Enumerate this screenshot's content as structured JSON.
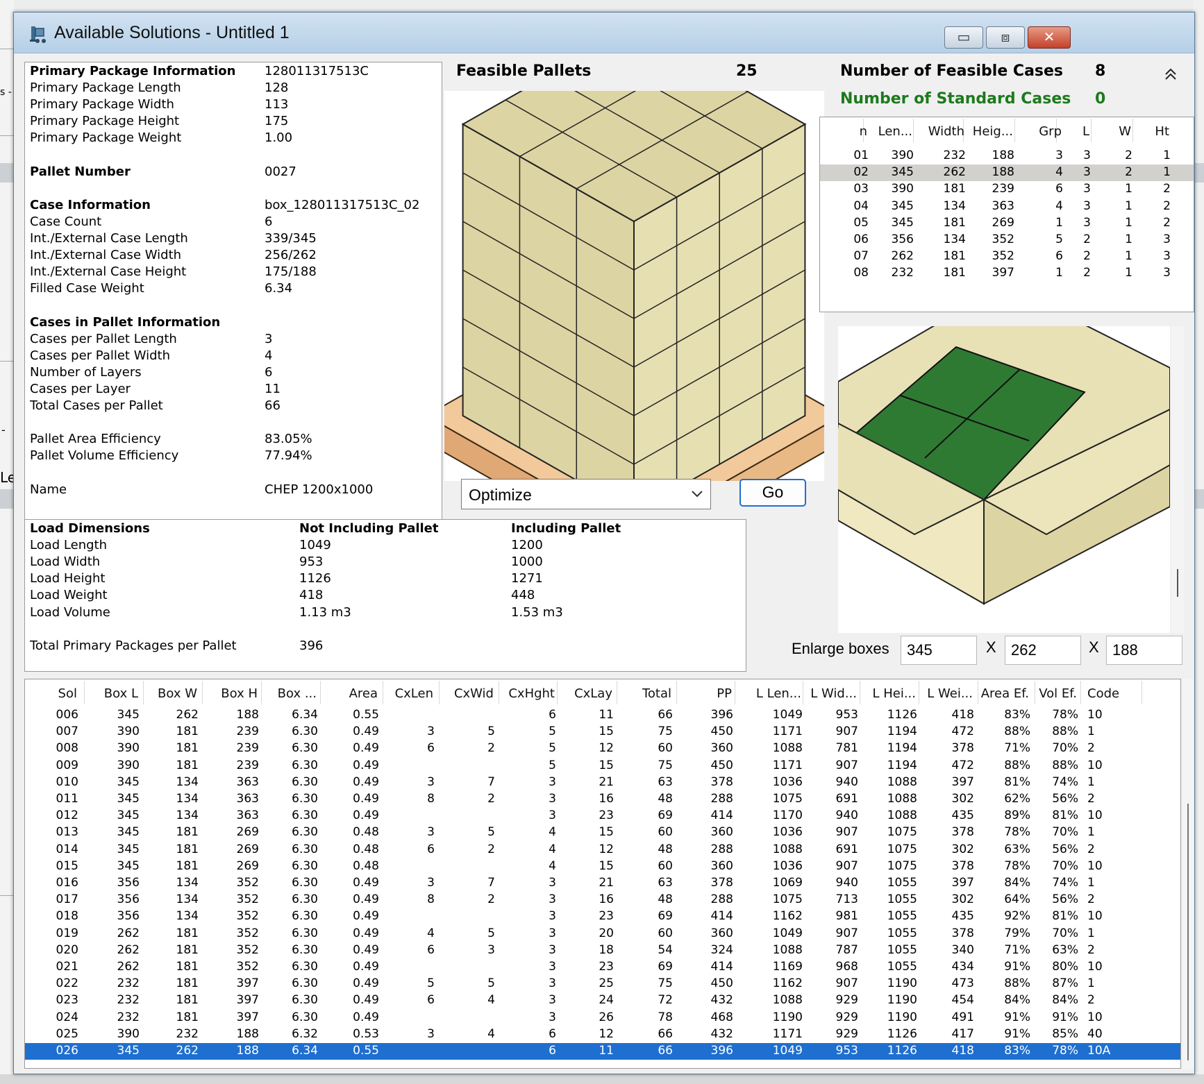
{
  "window": {
    "title": "Available Solutions - Untitled 1",
    "minimize_glyph": "▭",
    "maximize_glyph": "⧈",
    "close_glyph": "✕"
  },
  "background": {
    "edge_glyph_1": "s -",
    "edge_glyph_2": "-",
    "edge_glyph_3": "Le"
  },
  "info": {
    "rows": [
      {
        "label": "Primary Package Information",
        "value": "128011317513C",
        "bold": true
      },
      {
        "label": "Primary Package Length",
        "value": "128"
      },
      {
        "label": "Primary Package Width",
        "value": "113"
      },
      {
        "label": "Primary Package Height",
        "value": "175"
      },
      {
        "label": "Primary Package Weight",
        "value": "1.00"
      },
      {
        "label": "",
        "value": ""
      },
      {
        "label": "Pallet Number",
        "value": "0027",
        "bold": true
      },
      {
        "label": "",
        "value": ""
      },
      {
        "label": "Case Information",
        "value": "box_128011317513C_02",
        "bold": true
      },
      {
        "label": "Case Count",
        "value": "6"
      },
      {
        "label": "Int./External Case Length",
        "value": "339/345"
      },
      {
        "label": "Int./External Case Width",
        "value": "256/262"
      },
      {
        "label": "Int./External Case Height",
        "value": "175/188"
      },
      {
        "label": "Filled Case Weight",
        "value": "6.34"
      },
      {
        "label": "",
        "value": ""
      },
      {
        "label": "Cases in Pallet Information",
        "value": "",
        "bold": true
      },
      {
        "label": "Cases per Pallet Length",
        "value": "3"
      },
      {
        "label": "Cases per Pallet Width",
        "value": "4"
      },
      {
        "label": "Number of Layers",
        "value": "6"
      },
      {
        "label": "Cases per Layer",
        "value": "11"
      },
      {
        "label": "Total Cases per Pallet",
        "value": "66"
      },
      {
        "label": "",
        "value": ""
      },
      {
        "label": "Pallet Area Efficiency",
        "value": "83.05%"
      },
      {
        "label": "Pallet Volume Efficiency",
        "value": "77.94%"
      },
      {
        "label": "",
        "value": ""
      },
      {
        "label": "Name",
        "value": "CHEP 1200x1000"
      }
    ]
  },
  "load": {
    "rows": [
      {
        "label": "Load Dimensions",
        "not_incl": "Not Including Pallet",
        "incl": "Including Pallet",
        "bold": true
      },
      {
        "label": "Load Length",
        "not_incl": "1049",
        "incl": "1200"
      },
      {
        "label": "Load Width",
        "not_incl": "953",
        "incl": "1000"
      },
      {
        "label": "Load Height",
        "not_incl": "1126",
        "incl": "1271"
      },
      {
        "label": "Load Weight",
        "not_incl": "418",
        "incl": "448"
      },
      {
        "label": "Load Volume",
        "not_incl": "1.13 m3",
        "incl": "1.53 m3"
      },
      {
        "label": "",
        "not_incl": "",
        "incl": ""
      },
      {
        "label": "Total Primary Packages per Pallet",
        "not_incl": "396",
        "incl": ""
      }
    ]
  },
  "feasible_pallets": {
    "label": "Feasible Pallets",
    "count": "25"
  },
  "optimize": {
    "selected": "Optimize",
    "go_label": "Go"
  },
  "cases_summary": {
    "feasible_label": "Number of Feasible Cases",
    "feasible_count": "8",
    "standard_label": "Number of Standard Cases",
    "standard_count": "0"
  },
  "case_table": {
    "headers": [
      "n",
      "Len...",
      "Width",
      "Heig...",
      "Grp",
      "L",
      "W",
      "Ht"
    ],
    "selected_index": 1,
    "rows": [
      [
        "01",
        "390",
        "232",
        "188",
        "3",
        "3",
        "2",
        "1"
      ],
      [
        "02",
        "345",
        "262",
        "188",
        "4",
        "3",
        "2",
        "1"
      ],
      [
        "03",
        "390",
        "181",
        "239",
        "6",
        "3",
        "1",
        "2"
      ],
      [
        "04",
        "345",
        "134",
        "363",
        "4",
        "3",
        "1",
        "2"
      ],
      [
        "05",
        "345",
        "181",
        "269",
        "1",
        "3",
        "1",
        "2"
      ],
      [
        "06",
        "356",
        "134",
        "352",
        "5",
        "2",
        "1",
        "3"
      ],
      [
        "07",
        "262",
        "181",
        "352",
        "6",
        "2",
        "1",
        "3"
      ],
      [
        "08",
        "232",
        "181",
        "397",
        "1",
        "2",
        "1",
        "3"
      ]
    ]
  },
  "enlarge": {
    "label": "Enlarge boxes",
    "x_sep": "X",
    "length": "345",
    "width": "262",
    "height": "188"
  },
  "solutions": {
    "headers": [
      "Sol",
      "Box L",
      "Box W",
      "Box H",
      "Box ...",
      "Area",
      "CxLen",
      "CxWid",
      "CxHght",
      "CxLay",
      "Total",
      "PP",
      "L Len...",
      "L Wid...",
      "L Hei...",
      "L Wei...",
      "Area Ef.",
      "Vol Ef.",
      "Code"
    ],
    "selected_index": 20,
    "rows": [
      [
        "006",
        "345",
        "262",
        "188",
        "6.34",
        "0.55",
        "",
        "",
        "6",
        "11",
        "66",
        "396",
        "1049",
        "953",
        "1126",
        "418",
        "83%",
        "78%",
        "10"
      ],
      [
        "007",
        "390",
        "181",
        "239",
        "6.30",
        "0.49",
        "3",
        "5",
        "5",
        "15",
        "75",
        "450",
        "1171",
        "907",
        "1194",
        "472",
        "88%",
        "88%",
        "1"
      ],
      [
        "008",
        "390",
        "181",
        "239",
        "6.30",
        "0.49",
        "6",
        "2",
        "5",
        "12",
        "60",
        "360",
        "1088",
        "781",
        "1194",
        "378",
        "71%",
        "70%",
        "2"
      ],
      [
        "009",
        "390",
        "181",
        "239",
        "6.30",
        "0.49",
        "",
        "",
        "5",
        "15",
        "75",
        "450",
        "1171",
        "907",
        "1194",
        "472",
        "88%",
        "88%",
        "10"
      ],
      [
        "010",
        "345",
        "134",
        "363",
        "6.30",
        "0.49",
        "3",
        "7",
        "3",
        "21",
        "63",
        "378",
        "1036",
        "940",
        "1088",
        "397",
        "81%",
        "74%",
        "1"
      ],
      [
        "011",
        "345",
        "134",
        "363",
        "6.30",
        "0.49",
        "8",
        "2",
        "3",
        "16",
        "48",
        "288",
        "1075",
        "691",
        "1088",
        "302",
        "62%",
        "56%",
        "2"
      ],
      [
        "012",
        "345",
        "134",
        "363",
        "6.30",
        "0.49",
        "",
        "",
        "3",
        "23",
        "69",
        "414",
        "1170",
        "940",
        "1088",
        "435",
        "89%",
        "81%",
        "10"
      ],
      [
        "013",
        "345",
        "181",
        "269",
        "6.30",
        "0.48",
        "3",
        "5",
        "4",
        "15",
        "60",
        "360",
        "1036",
        "907",
        "1075",
        "378",
        "78%",
        "70%",
        "1"
      ],
      [
        "014",
        "345",
        "181",
        "269",
        "6.30",
        "0.48",
        "6",
        "2",
        "4",
        "12",
        "48",
        "288",
        "1088",
        "691",
        "1075",
        "302",
        "63%",
        "56%",
        "2"
      ],
      [
        "015",
        "345",
        "181",
        "269",
        "6.30",
        "0.48",
        "",
        "",
        "4",
        "15",
        "60",
        "360",
        "1036",
        "907",
        "1075",
        "378",
        "78%",
        "70%",
        "10"
      ],
      [
        "016",
        "356",
        "134",
        "352",
        "6.30",
        "0.49",
        "3",
        "7",
        "3",
        "21",
        "63",
        "378",
        "1069",
        "940",
        "1055",
        "397",
        "84%",
        "74%",
        "1"
      ],
      [
        "017",
        "356",
        "134",
        "352",
        "6.30",
        "0.49",
        "8",
        "2",
        "3",
        "16",
        "48",
        "288",
        "1075",
        "713",
        "1055",
        "302",
        "64%",
        "56%",
        "2"
      ],
      [
        "018",
        "356",
        "134",
        "352",
        "6.30",
        "0.49",
        "",
        "",
        "3",
        "23",
        "69",
        "414",
        "1162",
        "981",
        "1055",
        "435",
        "92%",
        "81%",
        "10"
      ],
      [
        "019",
        "262",
        "181",
        "352",
        "6.30",
        "0.49",
        "4",
        "5",
        "3",
        "20",
        "60",
        "360",
        "1049",
        "907",
        "1055",
        "378",
        "79%",
        "70%",
        "1"
      ],
      [
        "020",
        "262",
        "181",
        "352",
        "6.30",
        "0.49",
        "6",
        "3",
        "3",
        "18",
        "54",
        "324",
        "1088",
        "787",
        "1055",
        "340",
        "71%",
        "63%",
        "2"
      ],
      [
        "021",
        "262",
        "181",
        "352",
        "6.30",
        "0.49",
        "",
        "",
        "3",
        "23",
        "69",
        "414",
        "1169",
        "968",
        "1055",
        "434",
        "91%",
        "80%",
        "10"
      ],
      [
        "022",
        "232",
        "181",
        "397",
        "6.30",
        "0.49",
        "5",
        "5",
        "3",
        "25",
        "75",
        "450",
        "1162",
        "907",
        "1190",
        "473",
        "88%",
        "87%",
        "1"
      ],
      [
        "023",
        "232",
        "181",
        "397",
        "6.30",
        "0.49",
        "6",
        "4",
        "3",
        "24",
        "72",
        "432",
        "1088",
        "929",
        "1190",
        "454",
        "84%",
        "84%",
        "2"
      ],
      [
        "024",
        "232",
        "181",
        "397",
        "6.30",
        "0.49",
        "",
        "",
        "3",
        "26",
        "78",
        "468",
        "1190",
        "929",
        "1190",
        "491",
        "91%",
        "91%",
        "10"
      ],
      [
        "025",
        "390",
        "232",
        "188",
        "6.32",
        "0.53",
        "3",
        "4",
        "6",
        "12",
        "66",
        "432",
        "1171",
        "929",
        "1126",
        "417",
        "91%",
        "85%",
        "40"
      ],
      [
        "026",
        "345",
        "262",
        "188",
        "6.34",
        "0.55",
        "",
        "",
        "6",
        "11",
        "66",
        "396",
        "1049",
        "953",
        "1126",
        "418",
        "83%",
        "78%",
        "10A"
      ]
    ]
  },
  "colors": {
    "selection_blue": "#1e6fd0",
    "row_highlight": "#d3d1cd",
    "green_label": "#1d7a1d",
    "case_tan": "#ddd4a3",
    "contents_green": "#2f7a33",
    "pallet_wood": "#f2c99a"
  },
  "icons": {
    "title_icon": "forklift-icon",
    "scroll_up": "scroll-up-icon",
    "dropdown": "chevron-down-icon"
  }
}
